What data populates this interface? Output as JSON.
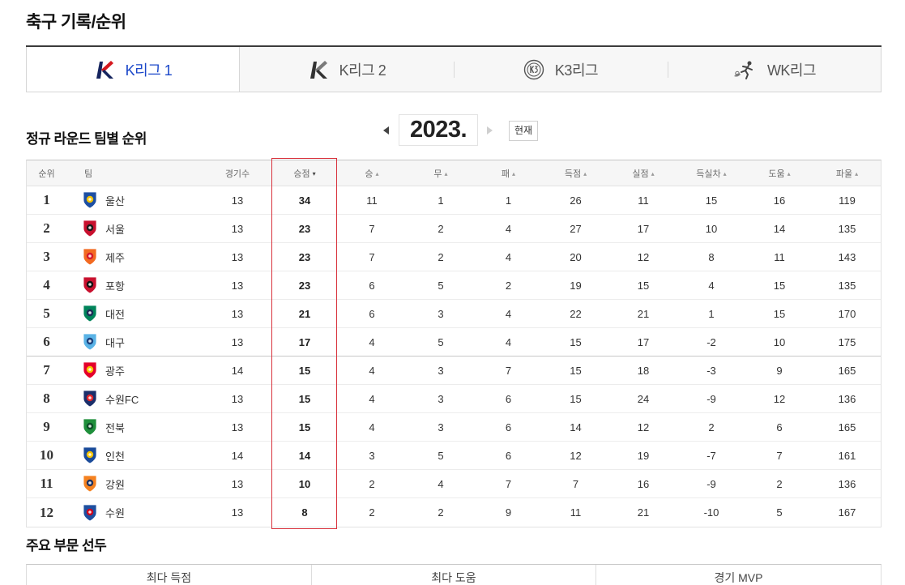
{
  "page_title": "축구 기록/순위",
  "league_tabs": [
    {
      "label": "K리그 1",
      "icon": "k-league-1-logo-icon",
      "selected": true
    },
    {
      "label": "K리그 2",
      "icon": "k-league-2-logo-icon",
      "selected": false
    },
    {
      "label": "K3리그",
      "icon": "k3-league-logo-icon",
      "selected": false
    },
    {
      "label": "WK리그",
      "icon": "wk-league-logo-icon",
      "selected": false
    }
  ],
  "season_nav": {
    "prev_icon": "triangle-left-icon",
    "year": "2023.",
    "next_icon": "triangle-right-icon",
    "next_disabled": true,
    "current_button": "현재"
  },
  "standings": {
    "title": "정규 라운드 팀별 순위",
    "columns": [
      {
        "label": "순위"
      },
      {
        "label": "팀"
      },
      {
        "label": "경기수"
      },
      {
        "label": "승점",
        "sort_icon": "sort-desc-icon",
        "highlighted": true
      },
      {
        "label": "승",
        "sort_icon": "sort-asc-icon"
      },
      {
        "label": "무",
        "sort_icon": "sort-asc-icon"
      },
      {
        "label": "패",
        "sort_icon": "sort-asc-icon"
      },
      {
        "label": "득점",
        "sort_icon": "sort-asc-icon"
      },
      {
        "label": "실점",
        "sort_icon": "sort-asc-icon"
      },
      {
        "label": "득실차",
        "sort_icon": "sort-asc-icon"
      },
      {
        "label": "도움",
        "sort_icon": "sort-asc-icon"
      },
      {
        "label": "파울",
        "sort_icon": "sort-asc-icon"
      }
    ],
    "rows": [
      {
        "rank": 1,
        "team": "울산",
        "logo": "ulsan-hyundai-emblem-icon",
        "logo_colors": [
          "#1d4fa3",
          "#f5c400"
        ],
        "played": 13,
        "points": 34,
        "won": 11,
        "drawn": 1,
        "lost": 1,
        "gf": 26,
        "ga": 11,
        "gd": 15,
        "assists": 16,
        "fouls": 119
      },
      {
        "rank": 2,
        "team": "서울",
        "logo": "fc-seoul-emblem-icon",
        "logo_colors": [
          "#c8102e",
          "#1a1a1a"
        ],
        "played": 13,
        "points": 23,
        "won": 7,
        "drawn": 2,
        "lost": 4,
        "gf": 27,
        "ga": 17,
        "gd": 10,
        "assists": 14,
        "fouls": 135
      },
      {
        "rank": 3,
        "team": "제주",
        "logo": "jeju-united-emblem-icon",
        "logo_colors": [
          "#f26a21",
          "#d3172c"
        ],
        "played": 13,
        "points": 23,
        "won": 7,
        "drawn": 2,
        "lost": 4,
        "gf": 20,
        "ga": 12,
        "gd": 8,
        "assists": 11,
        "fouls": 143
      },
      {
        "rank": 4,
        "team": "포항",
        "logo": "pohang-steelers-emblem-icon",
        "logo_colors": [
          "#c8102e",
          "#111111"
        ],
        "played": 13,
        "points": 23,
        "won": 6,
        "drawn": 5,
        "lost": 2,
        "gf": 19,
        "ga": 15,
        "gd": 4,
        "assists": 15,
        "fouls": 135
      },
      {
        "rank": 5,
        "team": "대전",
        "logo": "daejeon-hana-emblem-icon",
        "logo_colors": [
          "#00845a",
          "#1d2b57"
        ],
        "played": 13,
        "points": 21,
        "won": 6,
        "drawn": 3,
        "lost": 4,
        "gf": 22,
        "ga": 21,
        "gd": 1,
        "assists": 15,
        "fouls": 170
      },
      {
        "rank": 6,
        "team": "대구",
        "logo": "daegu-fc-emblem-icon",
        "logo_colors": [
          "#5ab3e6",
          "#1b3f7c"
        ],
        "played": 13,
        "points": 17,
        "won": 4,
        "drawn": 5,
        "lost": 4,
        "gf": 15,
        "ga": 17,
        "gd": -2,
        "assists": 10,
        "fouls": 175
      },
      {
        "rank": 7,
        "team": "광주",
        "logo": "gwangju-fc-emblem-icon",
        "logo_colors": [
          "#e4002b",
          "#f7c600"
        ],
        "played": 14,
        "points": 15,
        "won": 4,
        "drawn": 3,
        "lost": 7,
        "gf": 15,
        "ga": 18,
        "gd": -3,
        "assists": 9,
        "fouls": 165
      },
      {
        "rank": 8,
        "team": "수원FC",
        "logo": "suwon-fc-emblem-icon",
        "logo_colors": [
          "#1b2f6b",
          "#e5262b"
        ],
        "played": 13,
        "points": 15,
        "won": 4,
        "drawn": 3,
        "lost": 6,
        "gf": 15,
        "ga": 24,
        "gd": -9,
        "assists": 12,
        "fouls": 136
      },
      {
        "rank": 9,
        "team": "전북",
        "logo": "jeonbuk-hyundai-emblem-icon",
        "logo_colors": [
          "#1f8f3b",
          "#0b4d26"
        ],
        "played": 13,
        "points": 15,
        "won": 4,
        "drawn": 3,
        "lost": 6,
        "gf": 14,
        "ga": 12,
        "gd": 2,
        "assists": 6,
        "fouls": 165
      },
      {
        "rank": 10,
        "team": "인천",
        "logo": "incheon-united-emblem-icon",
        "logo_colors": [
          "#1a4b9a",
          "#f5c400"
        ],
        "played": 14,
        "points": 14,
        "won": 3,
        "drawn": 5,
        "lost": 6,
        "gf": 12,
        "ga": 19,
        "gd": -7,
        "assists": 7,
        "fouls": 161
      },
      {
        "rank": 11,
        "team": "강원",
        "logo": "gangwon-fc-emblem-icon",
        "logo_colors": [
          "#f58220",
          "#1e3261"
        ],
        "played": 13,
        "points": 10,
        "won": 2,
        "drawn": 4,
        "lost": 7,
        "gf": 7,
        "ga": 16,
        "gd": -9,
        "assists": 2,
        "fouls": 136
      },
      {
        "rank": 12,
        "team": "수원",
        "logo": "suwon-samsung-emblem-icon",
        "logo_colors": [
          "#1e4fa0",
          "#d0021b"
        ],
        "played": 13,
        "points": 8,
        "won": 2,
        "drawn": 2,
        "lost": 9,
        "gf": 11,
        "ga": 21,
        "gd": -10,
        "assists": 5,
        "fouls": 167
      }
    ]
  },
  "leaders": {
    "title": "주요 부문 선두",
    "tabs": [
      "최다 득점",
      "최다 도움",
      "경기 MVP"
    ]
  },
  "colors": {
    "selected_tab_text": "#1b47c9",
    "title_rule": "#3b3b3b",
    "tab_bg": "#f7f7f7",
    "header_bg": "#f6f6f6",
    "highlight_border": "#d8313b"
  }
}
